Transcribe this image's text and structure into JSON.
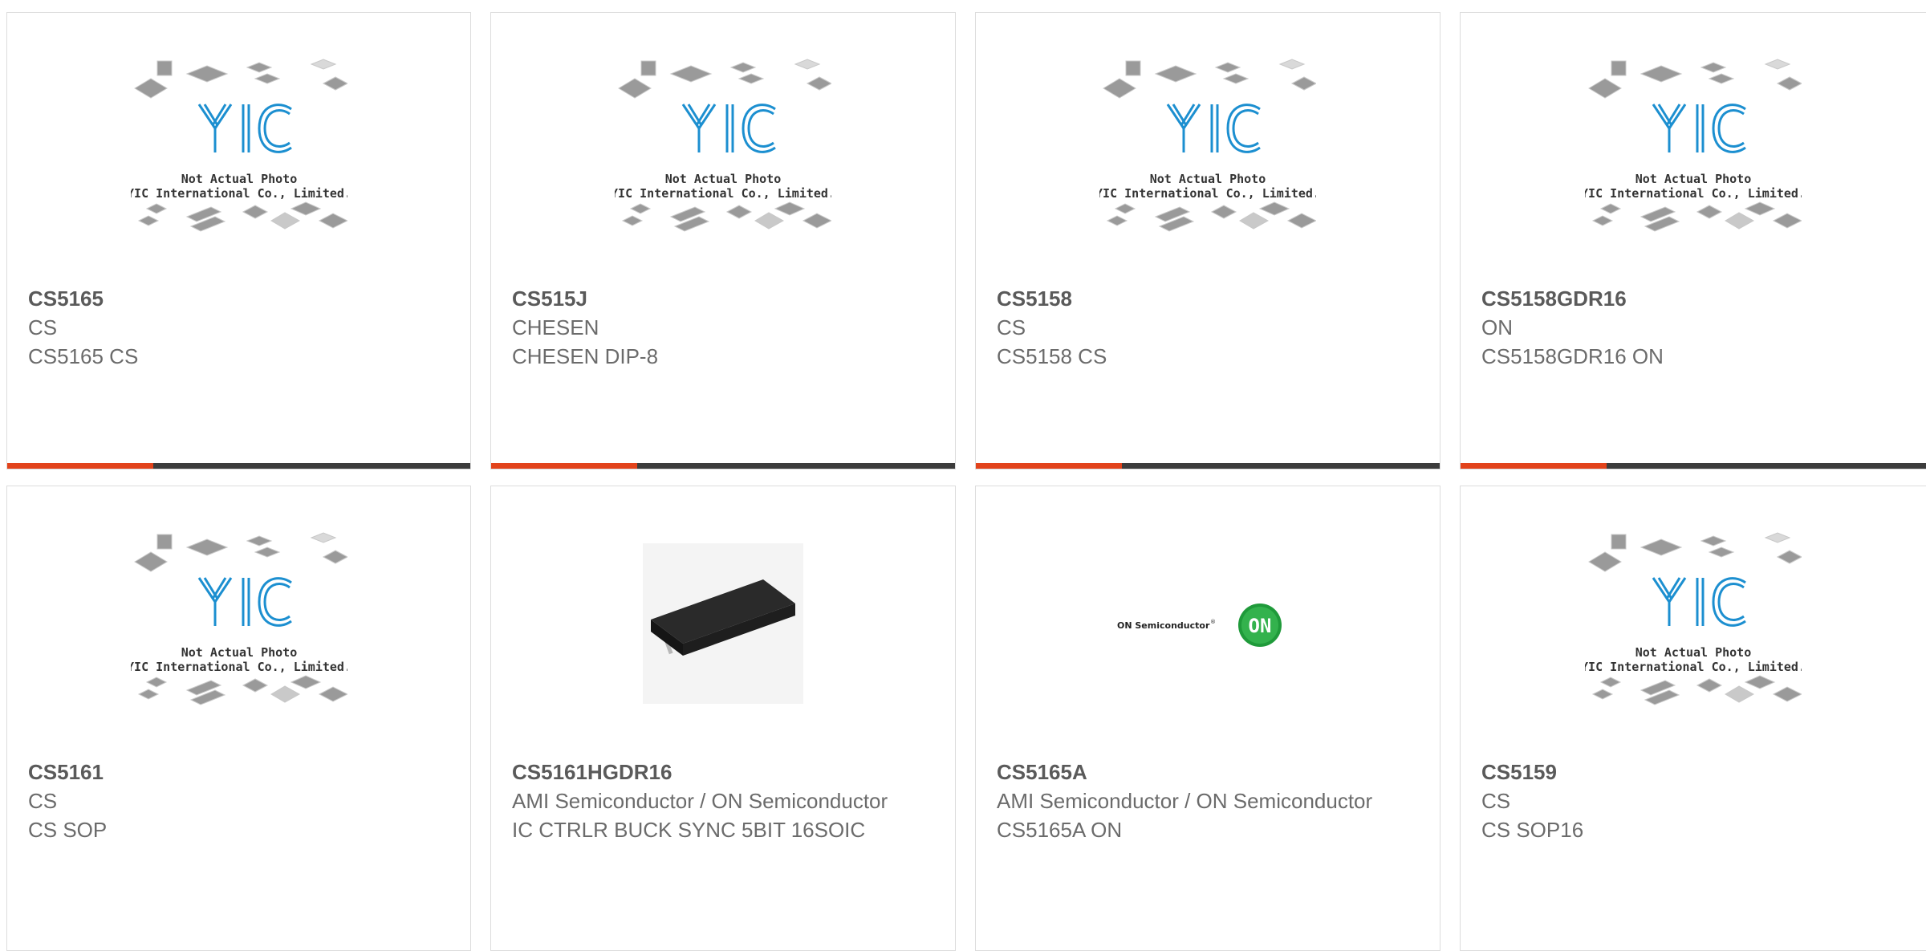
{
  "placeholder": {
    "logo_text": "YIC",
    "caption1": "Not Actual Photo",
    "caption2": "YIC International Co., Limited."
  },
  "brand_logo": {
    "text": "ON Semiconductor",
    "badge": "ON"
  },
  "colors": {
    "accent": "#e2431b",
    "bar": "#3c3c3c",
    "logo_blue": "#1c8fd0",
    "on_green": "#1f9a3a"
  },
  "cards": [
    {
      "part": "CS5165",
      "manufacturer": "CS",
      "description": "CS5165 CS",
      "image": "placeholder"
    },
    {
      "part": "CS515J",
      "manufacturer": "CHESEN",
      "description": "CHESEN DIP-8",
      "image": "placeholder"
    },
    {
      "part": "CS5158",
      "manufacturer": "CS",
      "description": "CS5158 CS",
      "image": "placeholder"
    },
    {
      "part": "CS5158GDR16",
      "manufacturer": "ON",
      "description": "CS5158GDR16 ON",
      "image": "placeholder"
    },
    {
      "part": "CS5161",
      "manufacturer": "CS",
      "description": "CS SOP",
      "image": "placeholder"
    },
    {
      "part": "CS5161HGDR16",
      "manufacturer": "AMI Semiconductor / ON Semiconductor",
      "description": "IC CTRLR BUCK SYNC 5BIT 16SOIC",
      "image": "chip-photo"
    },
    {
      "part": "CS5165A",
      "manufacturer": "AMI Semiconductor / ON Semiconductor",
      "description": "CS5165A ON",
      "image": "on-semiconductor-logo"
    },
    {
      "part": "CS5159",
      "manufacturer": "CS",
      "description": "CS SOP16",
      "image": "placeholder"
    }
  ]
}
